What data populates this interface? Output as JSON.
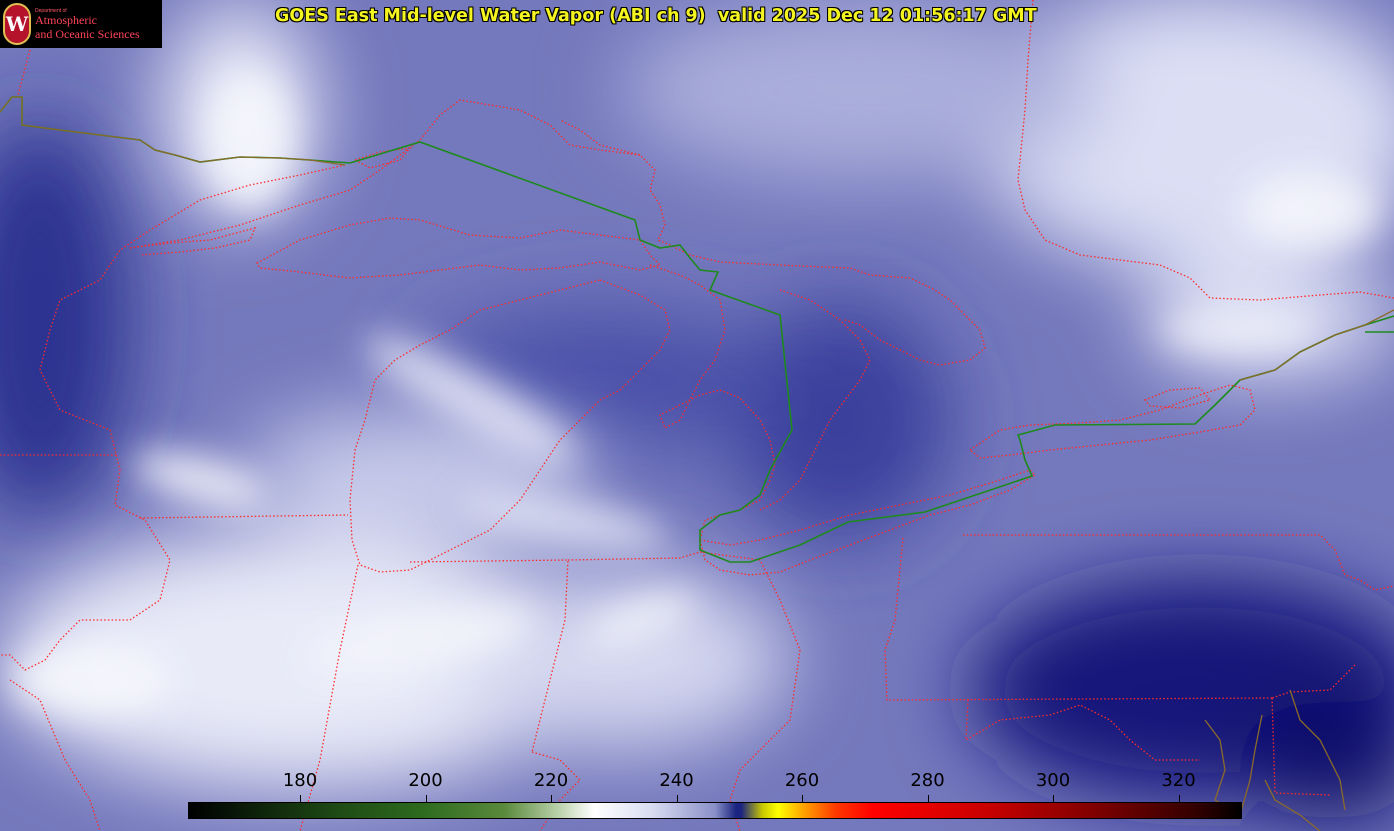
{
  "title": "GOES East Mid-level Water Vapor (ABI ch 9)  valid 2025 Dec 12 01:56:17 GMT",
  "logo": {
    "department": "Department of",
    "line1": "Atmospheric",
    "line2": "and Oceanic Sciences",
    "crest_letter": "W"
  },
  "colorbar": {
    "ticks": [
      "180",
      "200",
      "220",
      "240",
      "260",
      "280",
      "300",
      "320"
    ]
  },
  "colors": {
    "title": "#f4f420",
    "state_borders": "#ff2a2a",
    "international_border": "#1e8a1e",
    "coastlines": "#8a6a2a"
  }
}
